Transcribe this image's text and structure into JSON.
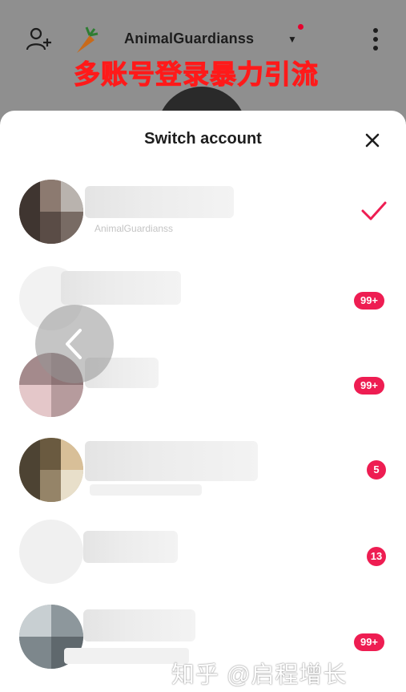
{
  "header": {
    "username": "AnimalGuardianss",
    "banner_text": "多账号登录暴力引流"
  },
  "sheet": {
    "title": "Switch account"
  },
  "accounts": [
    {
      "handle": "AnimalGuardianss",
      "badge": "",
      "selected": true
    },
    {
      "handle": "",
      "badge": "99+",
      "selected": false
    },
    {
      "handle": "",
      "badge": "99+",
      "selected": false
    },
    {
      "handle": "",
      "badge": "5",
      "selected": false
    },
    {
      "handle": "",
      "badge": "13",
      "selected": false
    },
    {
      "handle": "",
      "badge": "99+",
      "selected": false
    }
  ],
  "watermark": "知乎 @启程增长",
  "icons": {
    "add_user": "add-user-icon",
    "carrot": "carrot-icon",
    "more": "more-vertical-icon",
    "close": "close-icon",
    "check": "check-icon",
    "back": "chevron-left-icon"
  },
  "colors": {
    "accent": "#ee1d52",
    "banner": "#ff1a1a"
  }
}
